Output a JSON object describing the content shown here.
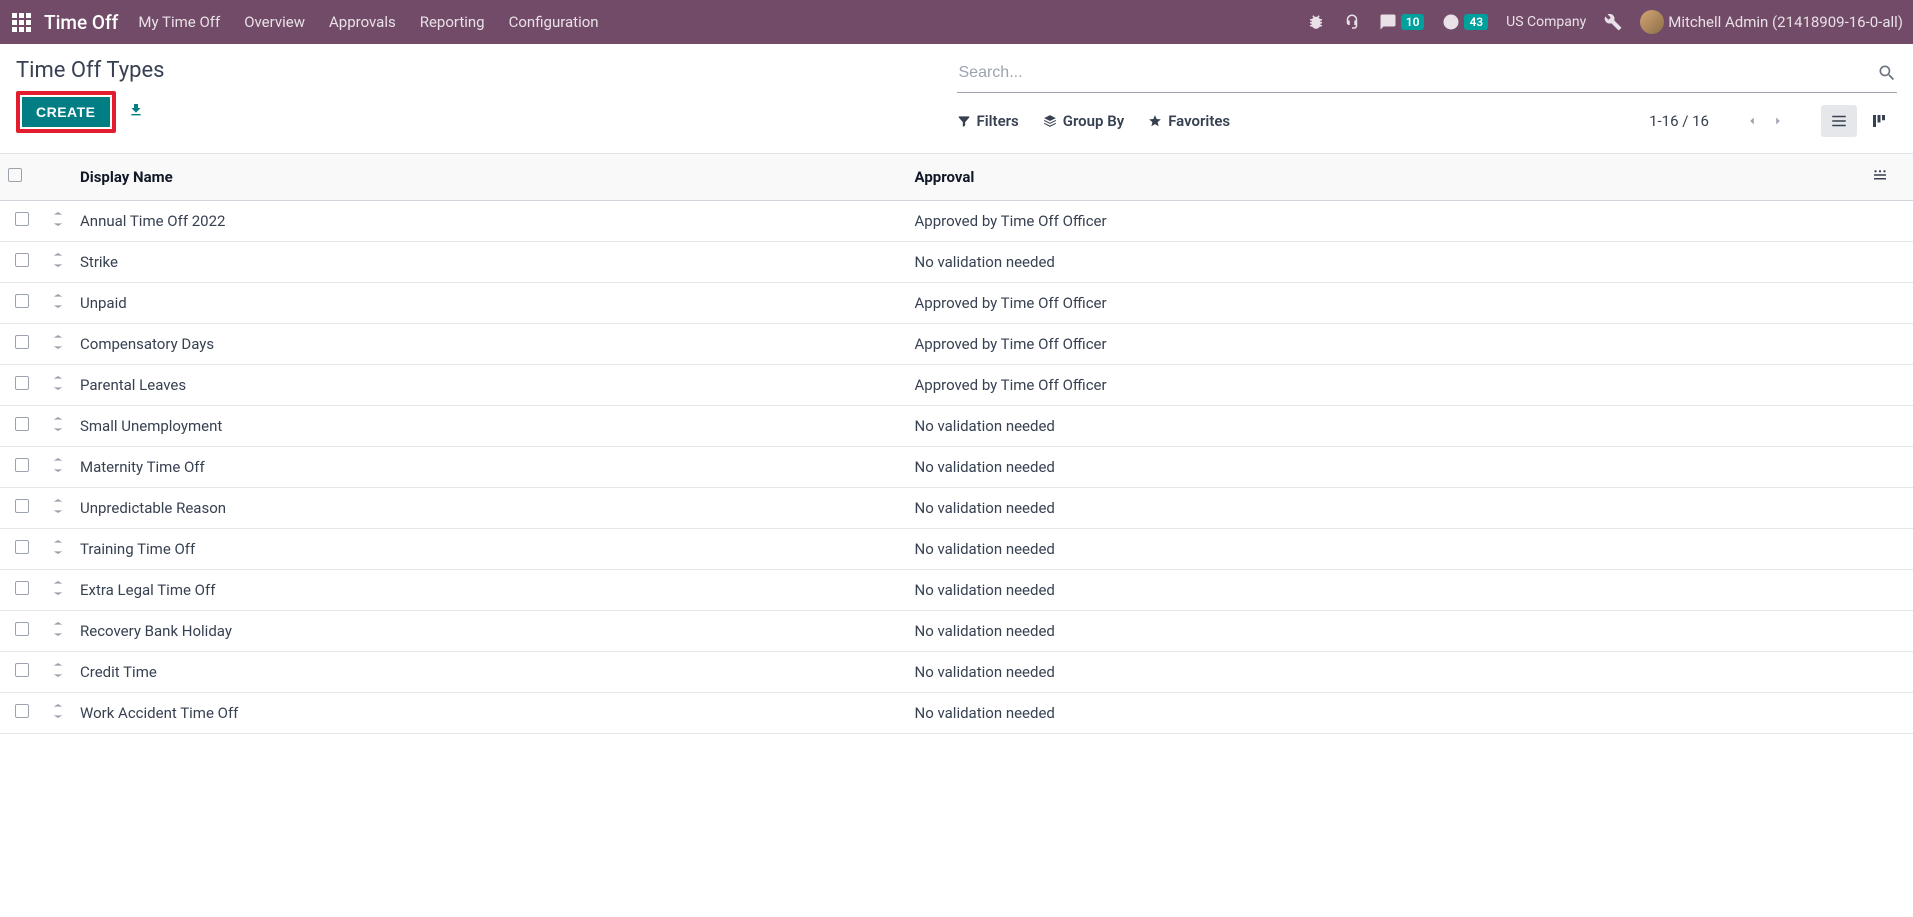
{
  "navbar": {
    "brand": "Time Off",
    "menu": [
      "My Time Off",
      "Overview",
      "Approvals",
      "Reporting",
      "Configuration"
    ],
    "messages_count": "10",
    "activities_count": "43",
    "company": "US Company",
    "user": "Mitchell Admin (21418909-16-0-all)"
  },
  "control_panel": {
    "title": "Time Off Types",
    "create_label": "CREATE",
    "search_placeholder": "Search...",
    "filters_label": "Filters",
    "groupby_label": "Group By",
    "favorites_label": "Favorites",
    "pager": "1-16 / 16"
  },
  "table": {
    "headers": {
      "name": "Display Name",
      "approval": "Approval"
    },
    "rows": [
      {
        "name": "Annual Time Off 2022",
        "approval": "Approved by Time Off Officer"
      },
      {
        "name": "Strike",
        "approval": "No validation needed"
      },
      {
        "name": "Unpaid",
        "approval": "Approved by Time Off Officer"
      },
      {
        "name": "Compensatory Days",
        "approval": "Approved by Time Off Officer"
      },
      {
        "name": "Parental Leaves",
        "approval": "Approved by Time Off Officer"
      },
      {
        "name": "Small Unemployment",
        "approval": "No validation needed"
      },
      {
        "name": "Maternity Time Off",
        "approval": "No validation needed"
      },
      {
        "name": "Unpredictable Reason",
        "approval": "No validation needed"
      },
      {
        "name": "Training Time Off",
        "approval": "No validation needed"
      },
      {
        "name": "Extra Legal Time Off",
        "approval": "No validation needed"
      },
      {
        "name": "Recovery Bank Holiday",
        "approval": "No validation needed"
      },
      {
        "name": "Credit Time",
        "approval": "No validation needed"
      },
      {
        "name": "Work Accident Time Off",
        "approval": "No validation needed"
      }
    ]
  }
}
